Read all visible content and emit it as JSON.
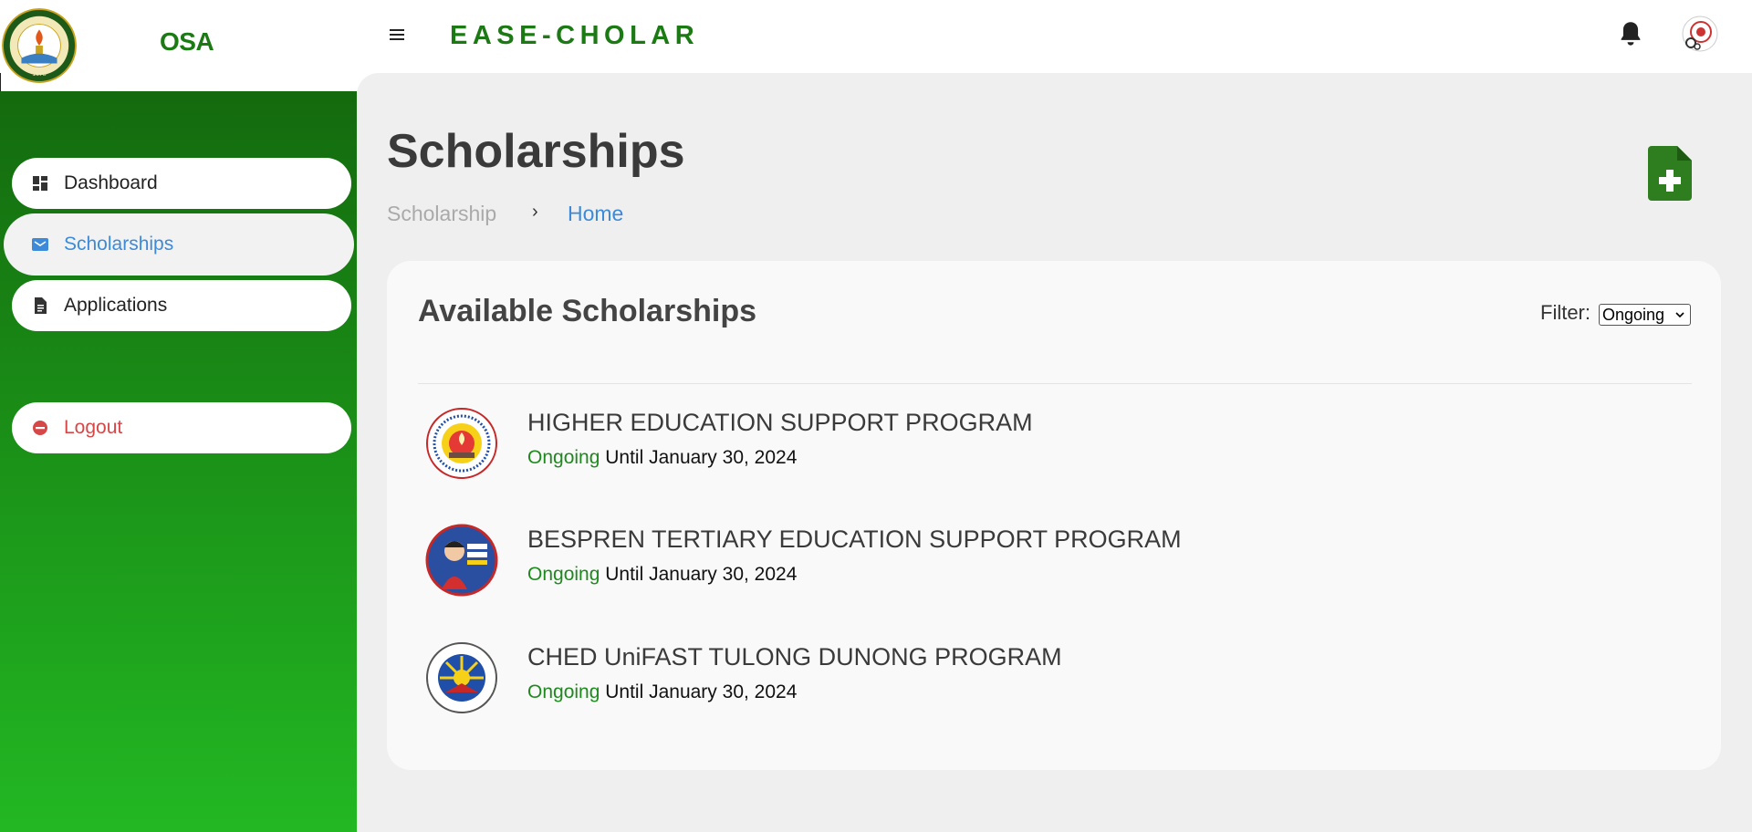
{
  "brand": {
    "org": "OSA",
    "app_title": "EASE-CHOLAR",
    "logo_text_top": "ISABELA STATE UNIVERSITY",
    "logo_year": "1978"
  },
  "header": {
    "notification_icon": "bell-icon",
    "avatar_icon": "user-avatar"
  },
  "sidebar": {
    "items": [
      {
        "label": "Dashboard",
        "icon": "dashboard-icon"
      },
      {
        "label": "Scholarships",
        "icon": "envelope-icon",
        "active": true
      },
      {
        "label": "Applications",
        "icon": "document-icon"
      },
      {
        "label": "Logout",
        "icon": "logout-icon"
      }
    ]
  },
  "page": {
    "title": "Scholarships",
    "breadcrumb": [
      "Scholarship",
      "Home"
    ],
    "breadcrumb_separator": "›",
    "add_icon": "add-document-icon"
  },
  "card": {
    "title": "Available Scholarships",
    "filter_label": "Filter:",
    "filter_value": "Ongoing",
    "scholarships": [
      {
        "name": "HIGHER EDUCATION SUPPORT PROGRAM",
        "status": "Ongoing",
        "until": "Until January 30, 2024"
      },
      {
        "name": "BESPREN TERTIARY EDUCATION SUPPORT PROGRAM",
        "status": "Ongoing",
        "until": "Until January 30, 2024"
      },
      {
        "name": "CHED UniFAST TULONG DUNONG PROGRAM",
        "status": "Ongoing",
        "until": "Until January 30, 2024"
      }
    ]
  },
  "colors": {
    "brand_green": "#1c7a14",
    "link_blue": "#3c8ad8",
    "status_green": "#1e8a1e",
    "logout_red": "#d84747"
  }
}
